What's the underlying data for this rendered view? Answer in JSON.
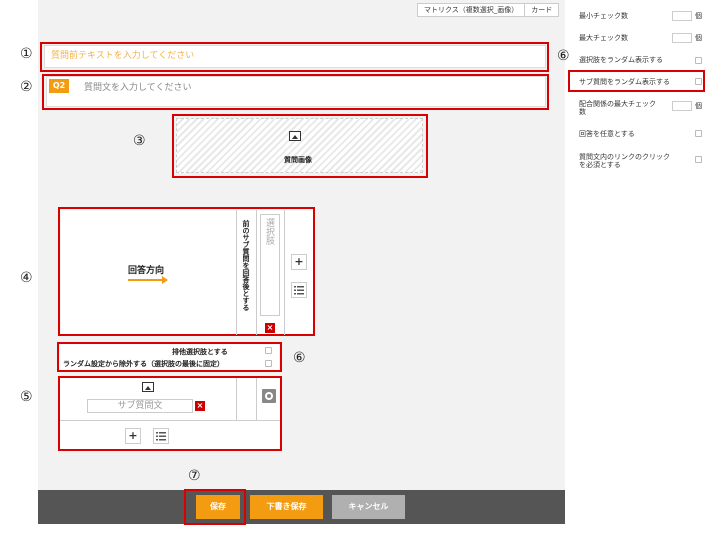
{
  "tabs": [
    "マトリクス（複数選択_画像）",
    "カード"
  ],
  "markers": {
    "m1": "①",
    "m2": "②",
    "m3": "③",
    "m4": "④",
    "m5": "⑤",
    "m6": "⑥",
    "m7": "⑦"
  },
  "question": {
    "pre_text_placeholder": "質問前テキストを入力してください",
    "badge": "Q2",
    "text_placeholder": "質問文を入力してください",
    "image_label": "質問画像"
  },
  "matrix": {
    "answer_direction": "回答方向",
    "column_header": "前のサブ質問を回答後とする",
    "choice_placeholder": "選択肢",
    "exclusive_label": "排他選択肢とする",
    "random_exclude_label": "ランダム設定から除外する（選択肢の最後に固定）",
    "sub_question_placeholder": "サブ質問文"
  },
  "footer": {
    "save": "保存",
    "draft": "下書き保存",
    "cancel": "キャンセル"
  },
  "sidebar": {
    "items": [
      {
        "label": "最小チェック数",
        "suffix": "個"
      },
      {
        "label": "最大チェック数",
        "suffix": "個"
      },
      {
        "label": "選択肢をランダム表示する"
      },
      {
        "label": "サブ質問をランダム表示する"
      },
      {
        "label_line1": "配合関係の最大チェック",
        "label_line2": "数",
        "suffix": "個"
      },
      {
        "label": "回答を任意とする"
      },
      {
        "label_line1": "質問文内のリンクのクリック",
        "label_line2": "を必須とする"
      }
    ]
  },
  "colors": {
    "accent": "#f39c12",
    "highlight": "#d80000",
    "footer": "#555555",
    "cancel": "#b0b0b0"
  }
}
